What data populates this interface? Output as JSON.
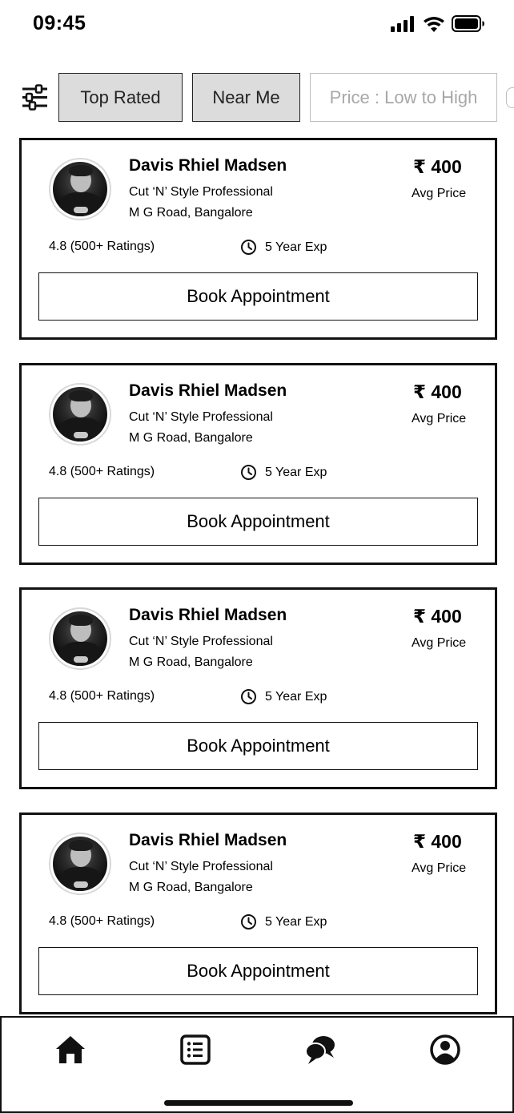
{
  "status_bar": {
    "time": "09:45",
    "icons": [
      "signal-icon",
      "wifi-icon",
      "battery-icon"
    ]
  },
  "filters": {
    "icon": "filter-sliders-icon",
    "chips": [
      {
        "label": "Top Rated",
        "state": "active"
      },
      {
        "label": "Near Me",
        "state": "active"
      },
      {
        "label": "Price : Low to High",
        "state": "inactive"
      }
    ]
  },
  "barbers": [
    {
      "name": "Davis Rhiel Madsen",
      "subtitle": "Cut ‘N’ Style Professional",
      "address": "M G Road, Bangalore",
      "price": "₹ 400",
      "price_label": "Avg Price",
      "rating": "4.8 (500+ Ratings)",
      "experience": "5 Year Exp",
      "button": "Book Appointment"
    },
    {
      "name": "Davis Rhiel Madsen",
      "subtitle": "Cut ‘N’ Style Professional",
      "address": "M G Road, Bangalore",
      "price": "₹ 400",
      "price_label": "Avg Price",
      "rating": "4.8 (500+ Ratings)",
      "experience": "5 Year Exp",
      "button": "Book Appointment"
    },
    {
      "name": "Davis Rhiel Madsen",
      "subtitle": "Cut ‘N’ Style Professional",
      "address": "M G Road, Bangalore",
      "price": "₹ 400",
      "price_label": "Avg Price",
      "rating": "4.8 (500+ Ratings)",
      "experience": "5 Year Exp",
      "button": "Book Appointment"
    },
    {
      "name": "Davis Rhiel Madsen",
      "subtitle": "Cut ‘N’ Style Professional",
      "address": "M G Road, Bangalore",
      "price": "₹ 400",
      "price_label": "Avg Price",
      "rating": "4.8 (500+ Ratings)",
      "experience": "5 Year Exp",
      "button": "Book Appointment"
    }
  ],
  "tab_bar": {
    "tabs": [
      "home-icon",
      "list-icon",
      "chat-icon",
      "profile-icon"
    ]
  },
  "colors": {
    "border": "#111111",
    "chip_active_bg": "#dcdcdc",
    "chip_inactive_text": "#a8a8a8"
  }
}
